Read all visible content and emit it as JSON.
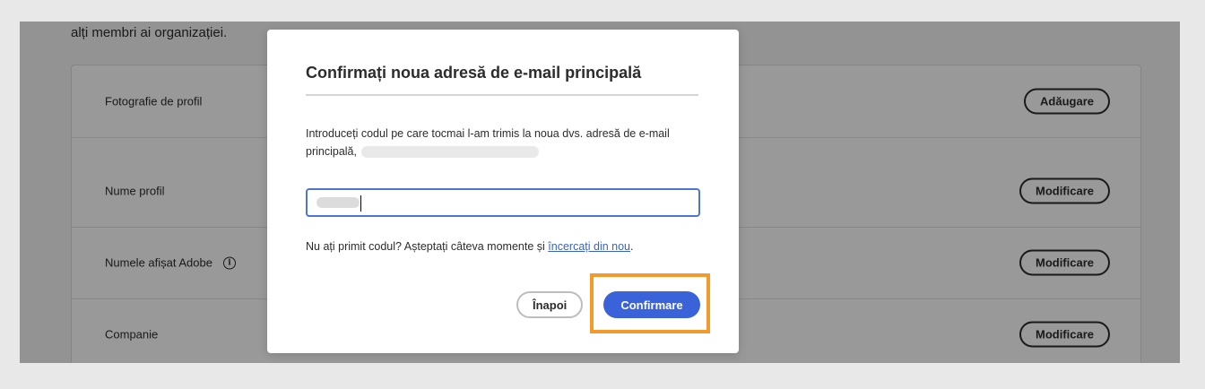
{
  "page": {
    "intro_text": "alți membri ai organizației."
  },
  "profile_rows": [
    {
      "label": "Fotografie de profil",
      "button": "Adăugare"
    },
    {
      "label": "Nume profil",
      "button": "Modificare"
    },
    {
      "label": "Numele afișat Adobe",
      "button": "Modificare"
    },
    {
      "label": "Companie",
      "button": "Modificare"
    }
  ],
  "dialog": {
    "title": "Confirmați noua adresă de e-mail principală",
    "description": "Introduceți codul pe care tocmai l-am trimis la noua dvs. adresă de e-mail principală,",
    "resend_text": "Nu ați primit codul? Așteptați câteva momente și",
    "resend_link": "încercați din nou",
    "resend_suffix": ".",
    "back_button": "Înapoi",
    "confirm_button": "Confirmare"
  },
  "colors": {
    "accent": "#3b63d9",
    "highlight": "#f39a2c",
    "link": "#3b63c4"
  },
  "icons": {
    "info": "info-icon"
  }
}
